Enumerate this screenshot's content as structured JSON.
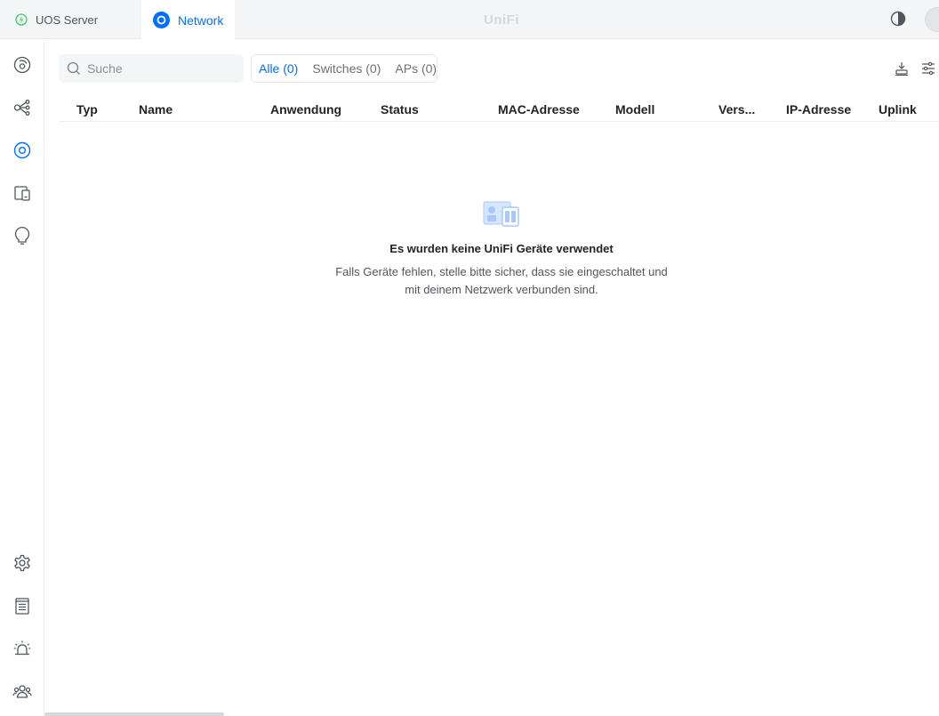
{
  "topbar": {
    "tabs": [
      {
        "label": "UOS Server",
        "icon": "uos-server-icon",
        "active": false
      },
      {
        "label": "Network",
        "icon": "network-icon",
        "active": true
      }
    ],
    "brand": "UniFi",
    "theme_toggle_icon": "contrast-icon",
    "avatar_icon": "user-avatar"
  },
  "sidebar": {
    "items": [
      {
        "name": "dashboard",
        "icon": "dashboard-icon"
      },
      {
        "name": "topology",
        "icon": "topology-icon"
      },
      {
        "name": "unifi-devices",
        "icon": "unifi-devices-icon",
        "active": true
      },
      {
        "name": "client-devices",
        "icon": "client-devices-icon"
      },
      {
        "name": "insights",
        "icon": "insights-icon"
      }
    ],
    "bottom_items": [
      {
        "name": "settings",
        "icon": "gear-icon"
      },
      {
        "name": "logs",
        "icon": "logs-icon"
      },
      {
        "name": "alarms",
        "icon": "alarm-icon"
      },
      {
        "name": "admins",
        "icon": "users-icon"
      }
    ]
  },
  "toolbar": {
    "search_placeholder": "Suche",
    "filters": [
      {
        "label": "Alle (0)",
        "active": true
      },
      {
        "label": "Switches (0)",
        "active": false
      },
      {
        "label": "APs (0)",
        "active": false
      }
    ]
  },
  "table": {
    "columns": [
      "Typ",
      "Name",
      "Anwendung",
      "Status",
      "MAC-Adresse",
      "Modell",
      "Vers...",
      "IP-Adresse",
      "Uplink"
    ]
  },
  "empty_state": {
    "title": "Es wurden keine UniFi Geräte verwendet",
    "line1": "Falls Geräte fehlen, stelle bitte sicher, dass sie eingeschaltet und",
    "line2": "mit deinem Netzwerk verbunden sind."
  },
  "colors": {
    "accent": "#006fff",
    "icon_gray": "#50565e",
    "empty_icon": "#a8c8fb",
    "success": "#38cc65"
  }
}
